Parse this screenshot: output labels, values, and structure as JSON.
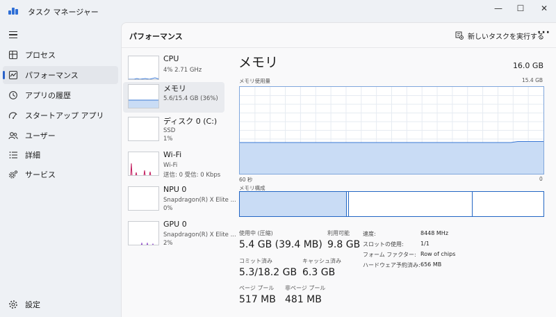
{
  "window": {
    "title": "タスク マネージャー",
    "minimize_glyph": "—",
    "maximize_glyph": "☐",
    "close_glyph": "✕"
  },
  "nav": {
    "items": [
      {
        "label": "プロセス",
        "icon": "processes-icon"
      },
      {
        "label": "パフォーマンス",
        "icon": "performance-icon",
        "active": true
      },
      {
        "label": "アプリの履歴",
        "icon": "app-history-icon"
      },
      {
        "label": "スタートアップ アプリ",
        "icon": "startup-icon"
      },
      {
        "label": "ユーザー",
        "icon": "users-icon"
      },
      {
        "label": "詳細",
        "icon": "details-icon"
      },
      {
        "label": "サービス",
        "icon": "services-icon"
      }
    ],
    "settings_label": "設定"
  },
  "header": {
    "title": "パフォーマンス",
    "run_task_label": "新しいタスクを実行する",
    "more_glyph": "···"
  },
  "devices": [
    {
      "name": "CPU",
      "line1": "4%  2.71 GHz",
      "line2": "",
      "line3": ""
    },
    {
      "name": "メモリ",
      "line1": "5.6/15.4 GB (36%)",
      "line2": "",
      "line3": ""
    },
    {
      "name": "ディスク 0 (C:)",
      "line1": "SSD",
      "line2": "1%",
      "line3": ""
    },
    {
      "name": "Wi-Fi",
      "line1": "Wi-Fi",
      "line2": "送信: 0  受信: 0 Kbps",
      "line3": ""
    },
    {
      "name": "NPU 0",
      "line1": "Snapdragon(R) X Elite ...",
      "line2": "0%",
      "line3": ""
    },
    {
      "name": "GPU 0",
      "line1": "Snapdragon(R) X Elite ...",
      "line2": "2%",
      "line3": ""
    }
  ],
  "memory": {
    "title": "メモリ",
    "total": "16.0 GB",
    "usage_label": "メモリ使用量",
    "usage_max": "15.4 GB",
    "time_left": "60 秒",
    "time_right": "0",
    "composition_label": "メモリ構成",
    "usage_fraction": 0.36,
    "stats": {
      "in_use_label": "使用中 (圧縮)",
      "in_use_value": "5.4 GB (39.4 MB)",
      "available_label": "利用可能",
      "available_value": "9.8 GB",
      "committed_label": "コミット済み",
      "committed_value": "5.3/18.2 GB",
      "cached_label": "キャッシュ済み",
      "cached_value": "6.3 GB",
      "paged_label": "ページ プール",
      "paged_value": "517 MB",
      "nonpaged_label": "非ページ プール",
      "nonpaged_value": "481 MB"
    },
    "details": [
      {
        "key": "速度:",
        "value": "8448 MHz"
      },
      {
        "key": "スロットの使用:",
        "value": "1/1"
      },
      {
        "key": "フォーム ファクター:",
        "value": "Row of chips"
      },
      {
        "key": "ハードウェア予約済み:",
        "value": "656 MB"
      }
    ]
  },
  "colors": {
    "memory_fill": "#c9dcf5",
    "memory_line": "#3a78d4",
    "wifi_line": "#c2185b",
    "gpu_line": "#8a3fc7",
    "accent": "#2a62c9"
  }
}
